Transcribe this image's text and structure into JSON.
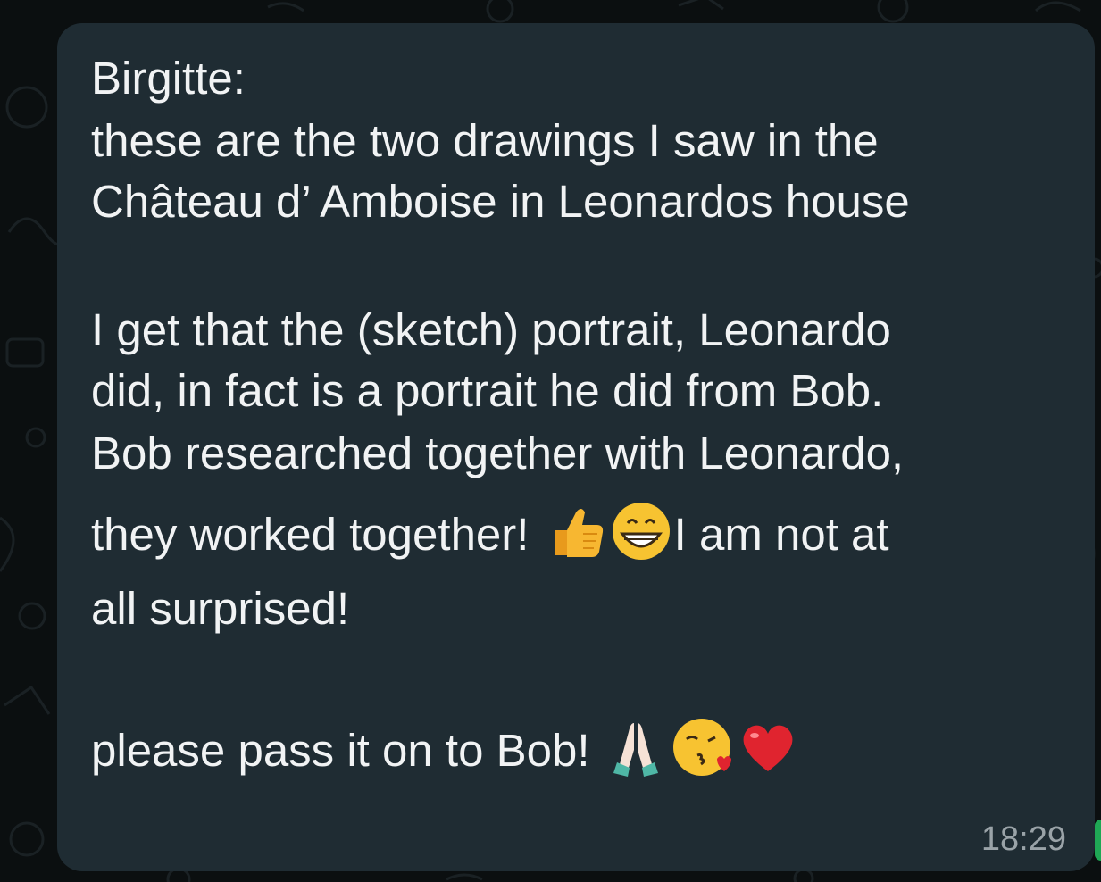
{
  "message": {
    "sender": "Birgitte:",
    "lines": {
      "l1": "these are  the two drawings I saw in the",
      "l2": "Château d’ Amboise in Leonardos house",
      "l3": "I get that the (sketch) portrait, Leonardo",
      "l4": "did, in fact is a portrait he did from Bob.",
      "l5": "Bob researched together with Leonardo,",
      "l6a": "they worked together! ",
      "l6b": "I am not at",
      "l7": "all surprised!",
      "l8": "please pass it on to Bob! "
    },
    "emojis": {
      "thumbs_up": "thumbs-up-icon",
      "grin": "grinning-face-icon",
      "pray": "folded-hands-icon",
      "kiss": "face-blowing-kiss-icon",
      "heart": "red-heart-icon"
    },
    "timestamp": "18:29"
  },
  "colors": {
    "bubble": "#1f2c33",
    "background": "#0b0f10",
    "text": "#f1f3f4",
    "timestamp": "#9aa3a8",
    "heart": "#e0242f",
    "emoji_yellow": "#f7b731"
  }
}
